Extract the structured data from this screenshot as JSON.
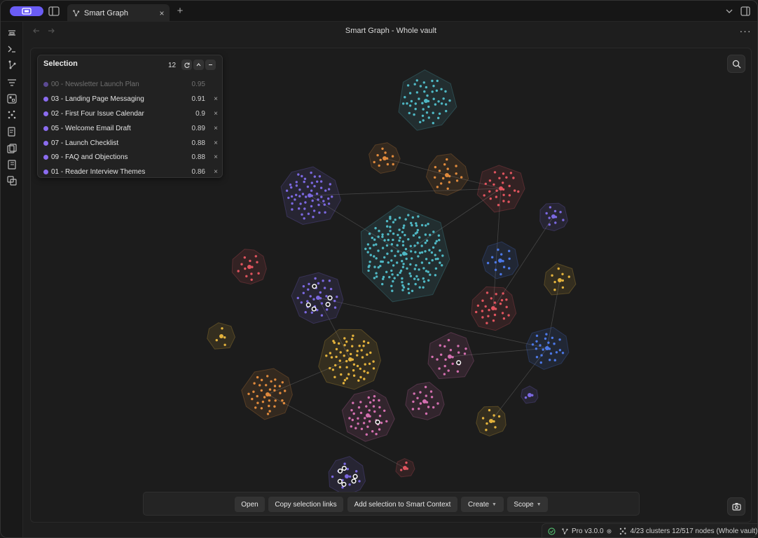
{
  "tab": {
    "title": "Smart Graph",
    "close_label": "×",
    "new_tab_label": "+"
  },
  "header": {
    "title": "Smart Graph - Whole vault",
    "more_label": "···"
  },
  "selection": {
    "title": "Selection",
    "count": "12",
    "items": [
      {
        "name": "00 - Newsletter Launch Plan",
        "score": "0.95",
        "dim": true
      },
      {
        "name": "03 - Landing Page Messaging",
        "score": "0.91"
      },
      {
        "name": "02 - First Four Issue Calendar",
        "score": "0.9"
      },
      {
        "name": "05 - Welcome Email Draft",
        "score": "0.89"
      },
      {
        "name": "07 - Launch Checklist",
        "score": "0.88"
      },
      {
        "name": "09 - FAQ and Objections",
        "score": "0.88"
      },
      {
        "name": "01 - Reader Interview Themes",
        "score": "0.86"
      }
    ],
    "remove_label": "×",
    "dot_color": "#8b6cf0"
  },
  "actions": {
    "open": "Open",
    "copy_links": "Copy selection links",
    "add_context": "Add selection to Smart Context",
    "create": "Create",
    "scope": "Scope"
  },
  "status": {
    "plan": "Pro v3.0.0",
    "graph_info": "4/23 clusters 12/517 nodes (Whole vault)"
  },
  "colors": {
    "accent": "#6a5cf5",
    "teal": "#4fb8c4",
    "purple": "#7b68e0",
    "orange": "#e08a3c",
    "red": "#e0545e",
    "pink": "#d46fb0",
    "yellow": "#e3b23c",
    "blue": "#4c78e6"
  },
  "icons": [
    "vault-icon",
    "sidebar-toggle-icon",
    "graph-icon",
    "search-icon",
    "camera-icon",
    "refresh-icon",
    "chevron-up-icon",
    "minus-icon",
    "check-circle-icon"
  ]
}
